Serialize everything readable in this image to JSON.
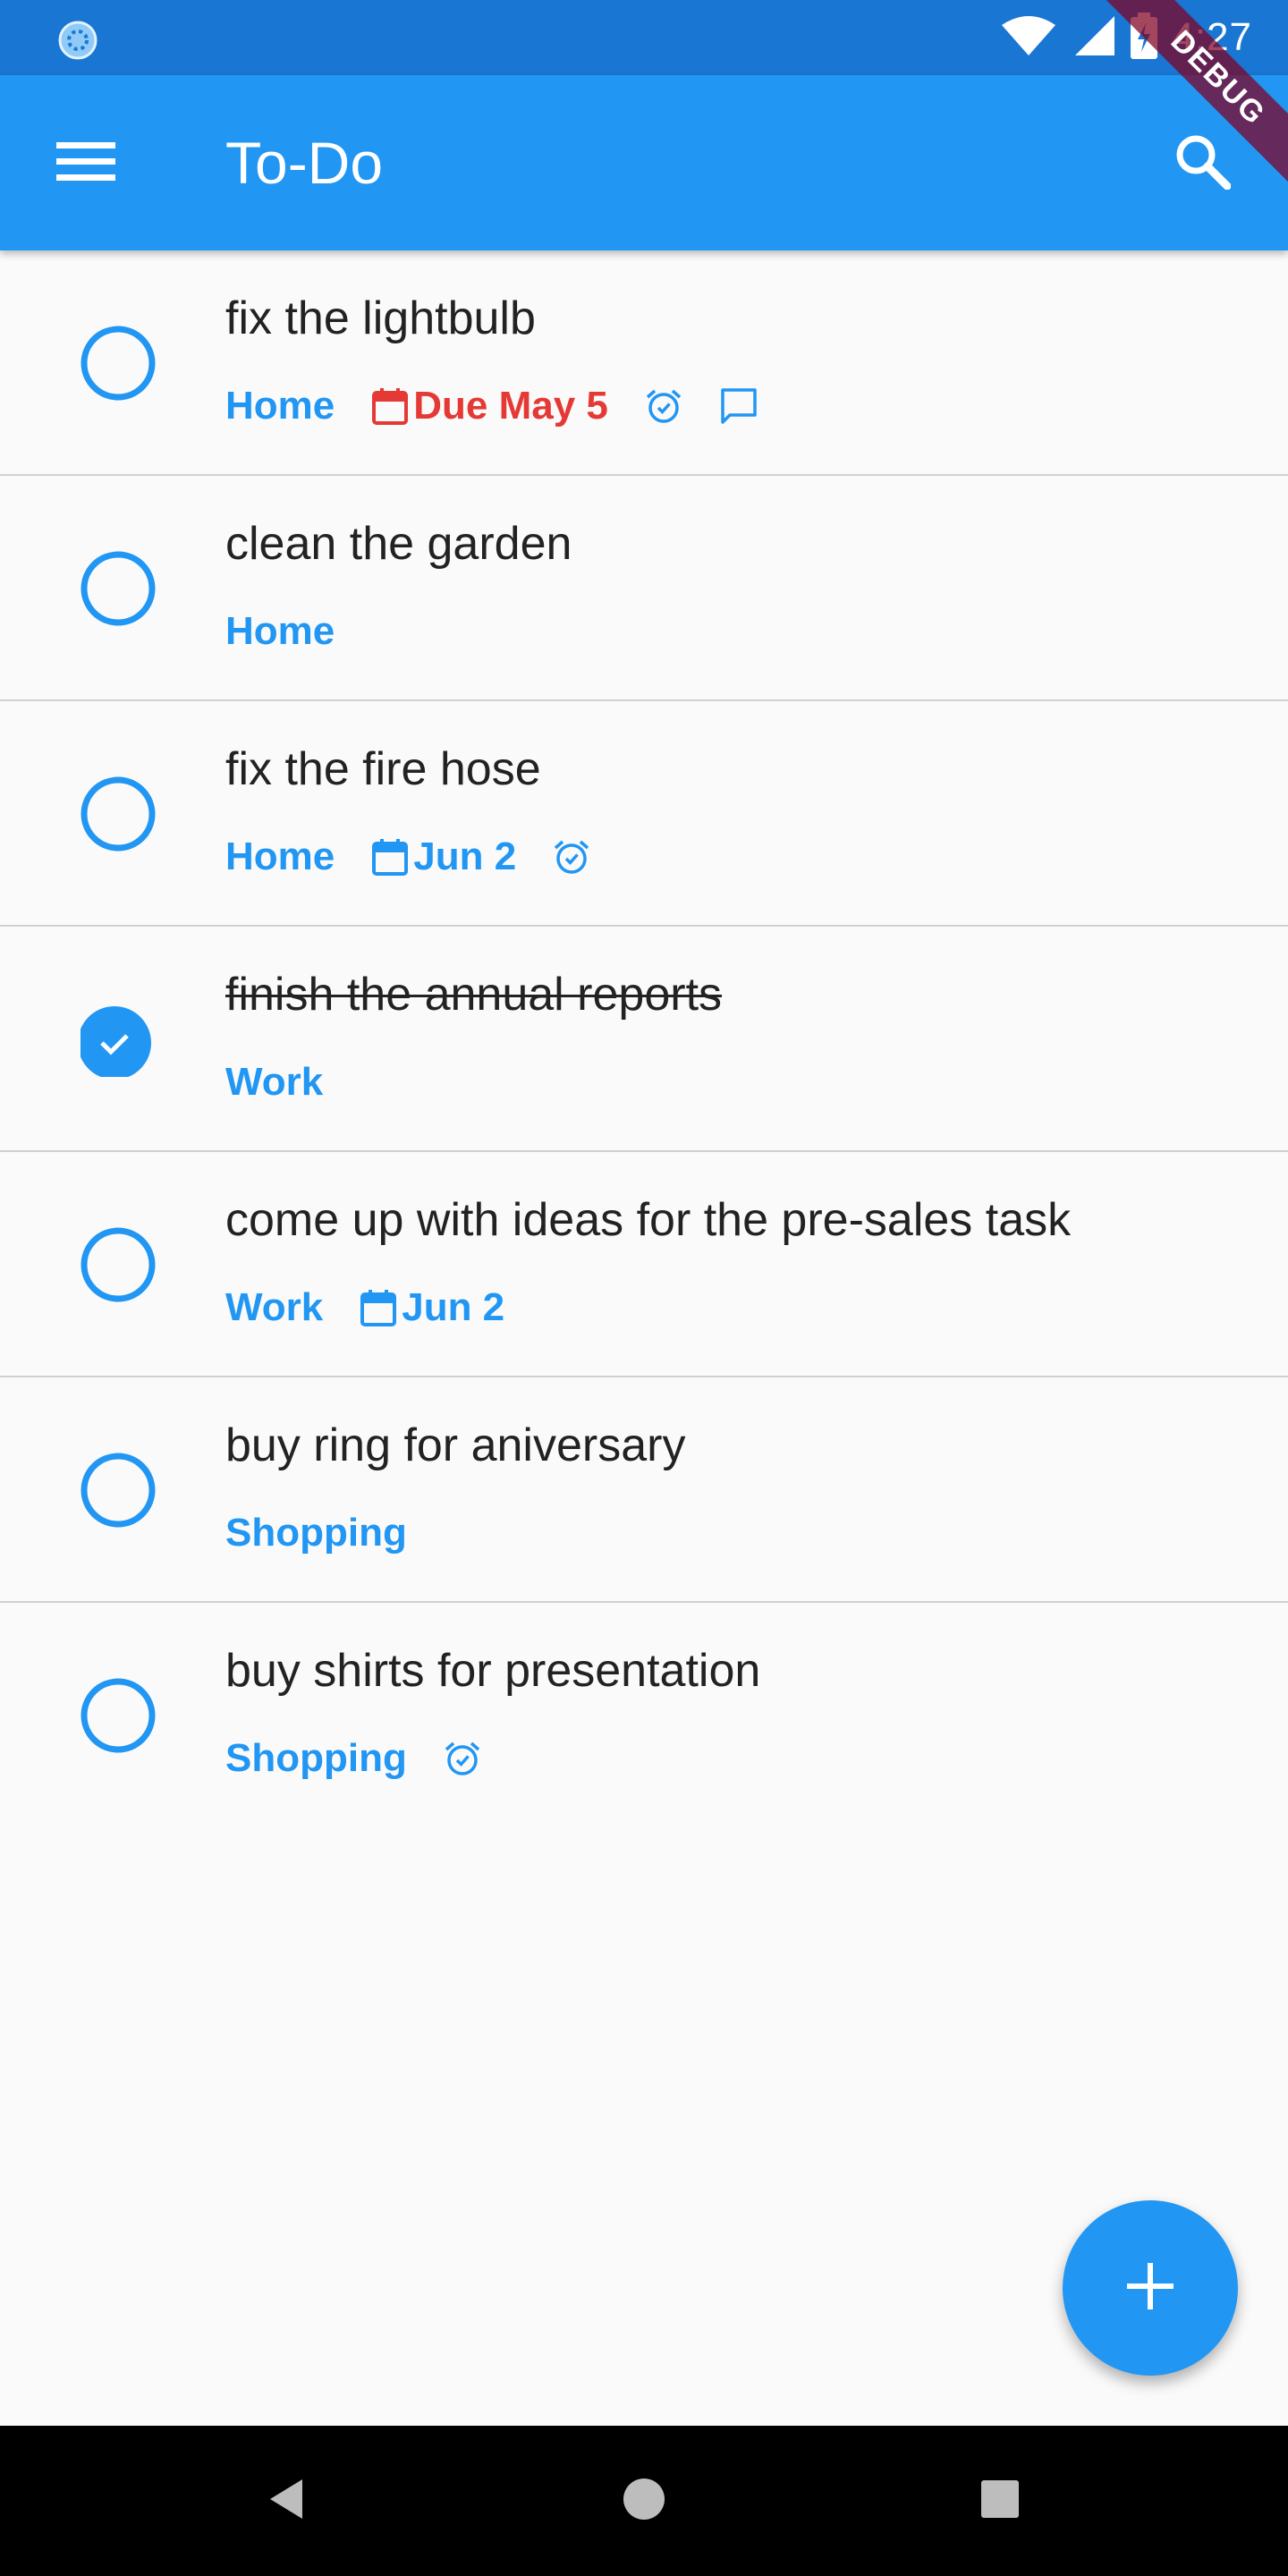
{
  "status_bar": {
    "time": "4:27",
    "icons": [
      "loading-icon",
      "wifi-icon",
      "signal-icon",
      "battery-charging-icon"
    ]
  },
  "debug_banner": "DEBUG",
  "app_bar": {
    "title": "To-Do",
    "icons": [
      "menu-icon",
      "search-icon"
    ]
  },
  "colors": {
    "primary": "#2196f3",
    "status_bar": "#1976d2",
    "overdue": "#e53935",
    "text": "#222222"
  },
  "todos": [
    {
      "title": "fix the lightbulb",
      "done": false,
      "tag": "Home",
      "due": "Due May 5",
      "overdue": true,
      "alarm": true,
      "note": true
    },
    {
      "title": "clean the garden",
      "done": false,
      "tag": "Home",
      "due": "",
      "overdue": false,
      "alarm": false,
      "note": false
    },
    {
      "title": "fix the fire hose",
      "done": false,
      "tag": "Home",
      "due": "Jun 2",
      "overdue": false,
      "alarm": true,
      "note": false
    },
    {
      "title": "finish the annual reports",
      "done": true,
      "tag": "Work",
      "due": "",
      "overdue": false,
      "alarm": false,
      "note": false
    },
    {
      "title": "come up with ideas for the pre-sales task",
      "done": false,
      "tag": "Work",
      "due": "Jun 2",
      "overdue": false,
      "alarm": false,
      "note": false
    },
    {
      "title": "buy ring for aniversary",
      "done": false,
      "tag": "Shopping",
      "due": "",
      "overdue": false,
      "alarm": false,
      "note": false
    },
    {
      "title": "buy shirts for presentation",
      "done": false,
      "tag": "Shopping",
      "due": "",
      "overdue": false,
      "alarm": true,
      "note": false
    }
  ],
  "fab": {
    "icon": "plus-icon"
  },
  "nav_bar": {
    "icons": [
      "back-icon",
      "home-icon",
      "recents-icon"
    ]
  }
}
